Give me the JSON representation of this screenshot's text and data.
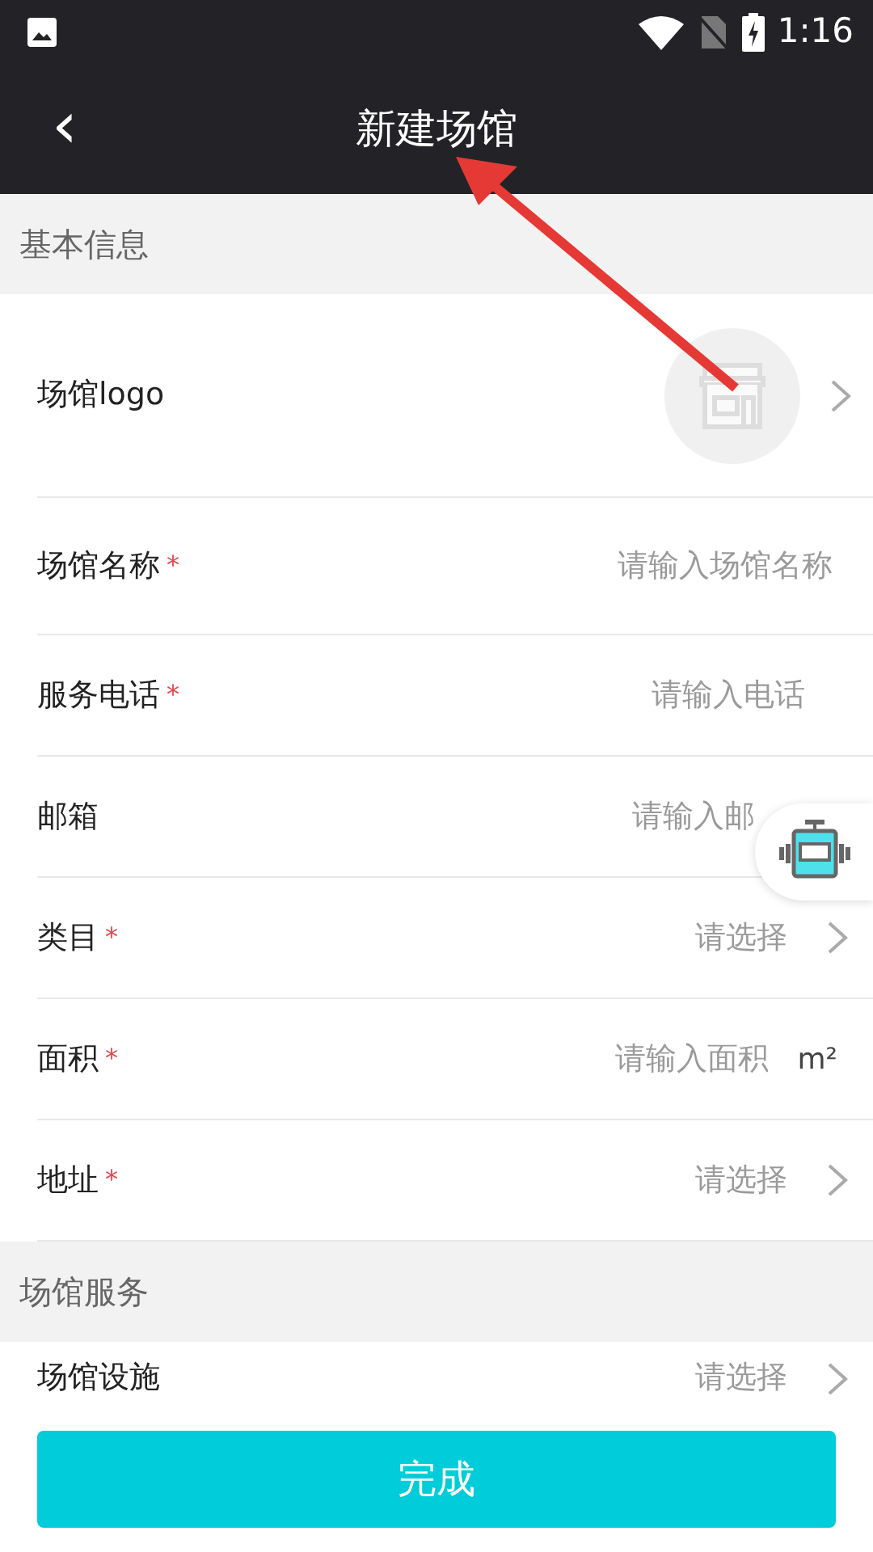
{
  "status_bar": {
    "time": "1:16"
  },
  "app_bar": {
    "back": "‹",
    "title": "新建场馆"
  },
  "sections": [
    {
      "title": "基本信息",
      "rows": [
        {
          "kind": "logo",
          "label": "场馆logo"
        },
        {
          "kind": "input",
          "label": "场馆名称",
          "required_mark": "*",
          "placeholder": "请输入场馆名称"
        },
        {
          "kind": "input",
          "label": "服务电话",
          "required_mark": "*",
          "placeholder": "请输入电话"
        },
        {
          "kind": "input",
          "label": "邮箱",
          "placeholder": "请输入邮"
        },
        {
          "kind": "select",
          "label": "类目",
          "required_mark": "*",
          "placeholder": "请选择"
        },
        {
          "kind": "unit",
          "label": "面积",
          "required_mark": "*",
          "placeholder": "请输入面积",
          "unit": "m²"
        },
        {
          "kind": "select",
          "label": "地址",
          "required_mark": "*",
          "placeholder": "请选择"
        }
      ]
    },
    {
      "title": "场馆服务",
      "rows": [
        {
          "kind": "select",
          "label": "场馆设施",
          "placeholder": "请选择"
        }
      ]
    }
  ],
  "submit": "完成"
}
